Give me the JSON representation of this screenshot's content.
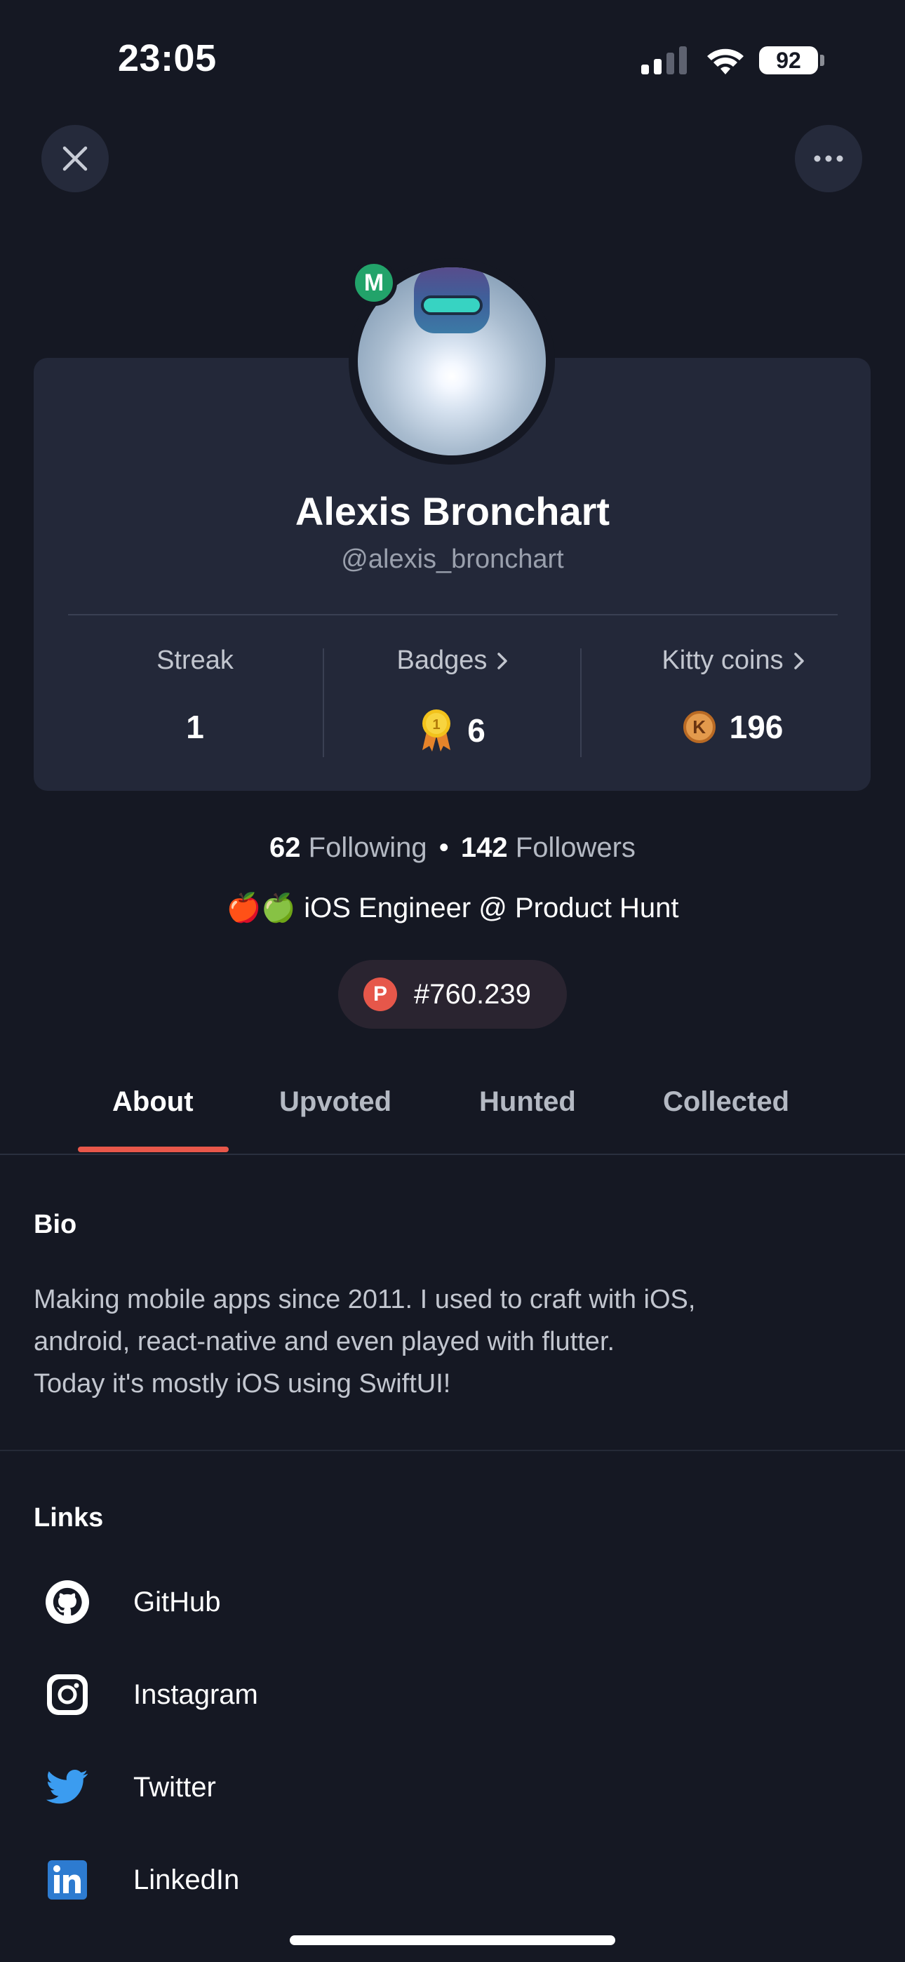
{
  "status_bar": {
    "time": "23:05",
    "battery": "92"
  },
  "top_actions": {
    "close_icon": "close-icon",
    "more_icon": "more-horizontal-icon"
  },
  "profile": {
    "avatar_badge": "M",
    "name": "Alexis Bronchart",
    "handle": "@alexis_bronchart"
  },
  "stats": [
    {
      "label": "Streak",
      "value": "1",
      "has_chevron": false
    },
    {
      "label": "Badges",
      "value": "6",
      "has_chevron": true,
      "icon": "medal-icon"
    },
    {
      "label": "Kitty coins",
      "value": "196",
      "has_chevron": true,
      "icon": "kitty-coin-icon",
      "coin_letter": "K"
    }
  ],
  "social": {
    "following_count": "62",
    "following_label": "Following",
    "separator": "•",
    "followers_count": "142",
    "followers_label": "Followers"
  },
  "headline": "🍎🍏 iOS Engineer @ Product Hunt",
  "rank": {
    "logo_letter": "P",
    "value": "#760.239"
  },
  "tabs": [
    {
      "label": "About",
      "active": true
    },
    {
      "label": "Upvoted",
      "active": false
    },
    {
      "label": "Hunted",
      "active": false
    },
    {
      "label": "Collected",
      "active": false
    }
  ],
  "bio": {
    "title": "Bio",
    "lines": [
      "Making mobile apps since 2011. I used to craft with iOS,",
      "android, react-native and even played with flutter.",
      "Today it's mostly iOS using SwiftUI!"
    ]
  },
  "links": {
    "title": "Links",
    "items": [
      {
        "label": "GitHub",
        "icon": "github-icon"
      },
      {
        "label": "Instagram",
        "icon": "instagram-icon"
      },
      {
        "label": "Twitter",
        "icon": "twitter-icon"
      },
      {
        "label": "LinkedIn",
        "icon": "linkedin-icon"
      }
    ]
  },
  "colors": {
    "background": "#151823",
    "card": "#232839",
    "accent": "#e8574a",
    "avatar_badge": "#22a36a"
  }
}
